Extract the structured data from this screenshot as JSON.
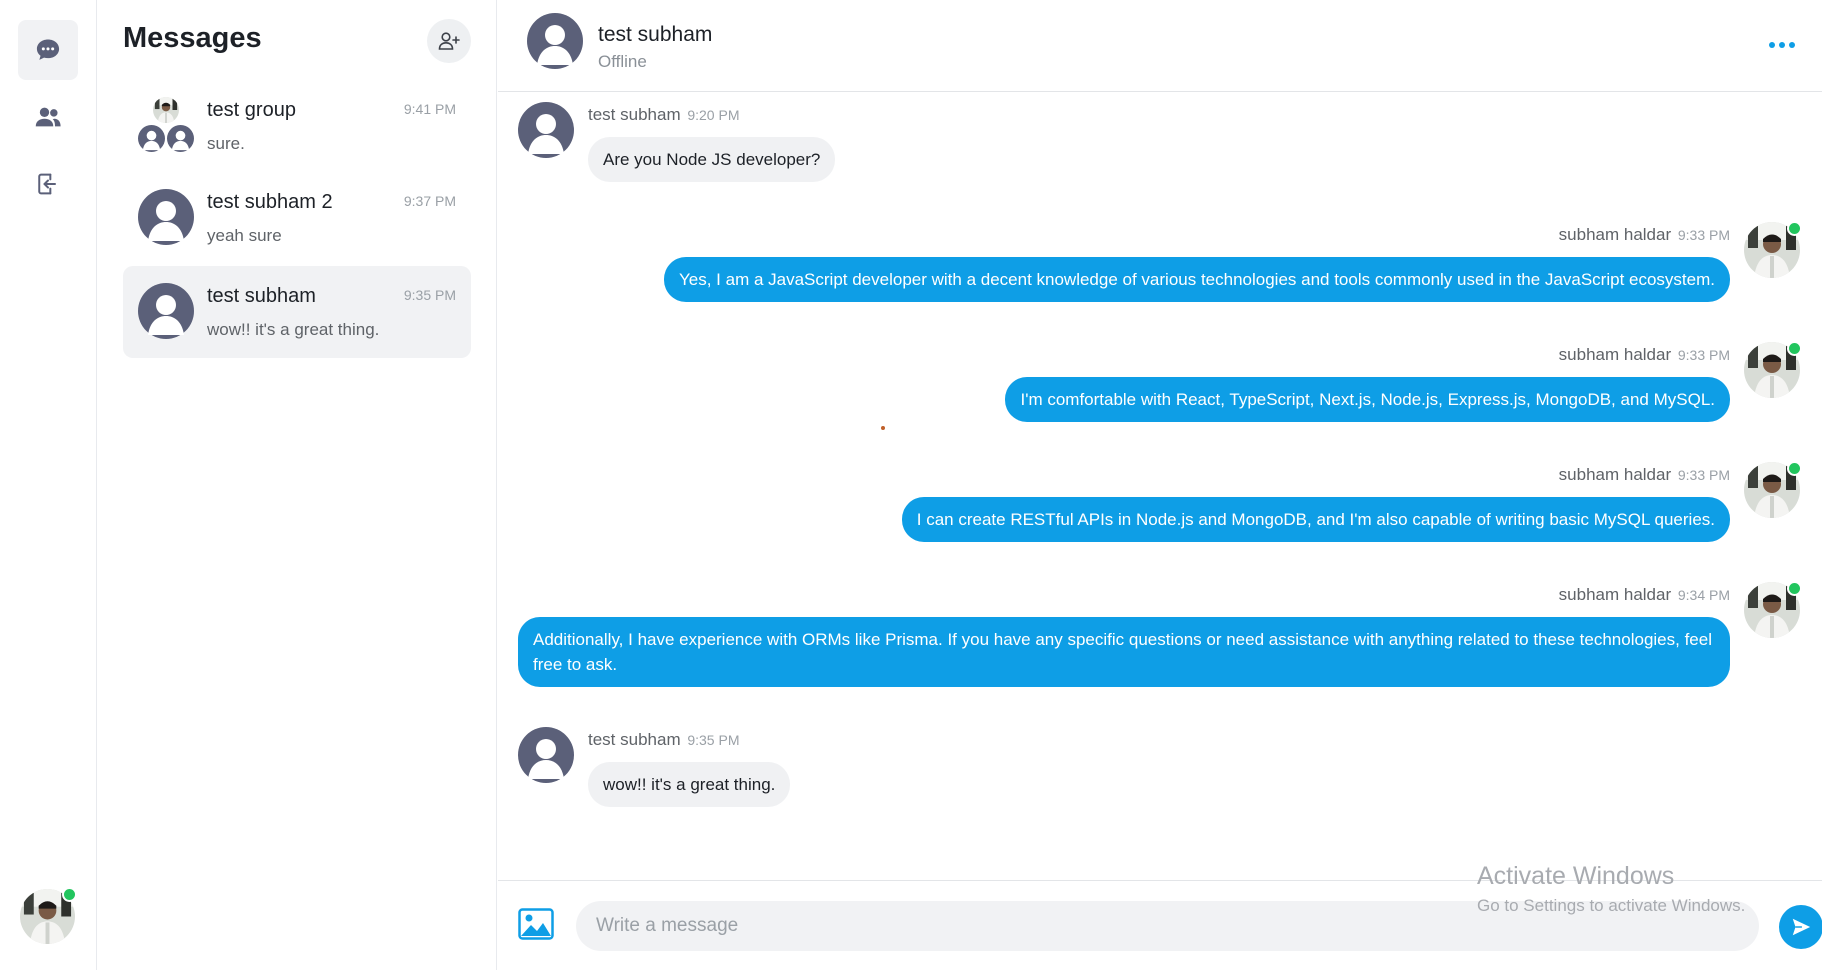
{
  "rail": {
    "items": [
      {
        "icon": "chat-bubble-icon",
        "active": true
      },
      {
        "icon": "users-icon",
        "active": false
      },
      {
        "icon": "logout-icon",
        "active": false
      }
    ]
  },
  "sidebar": {
    "title": "Messages",
    "add_icon": "add-user-icon",
    "conversations": [
      {
        "name": "test group",
        "time": "9:41 PM",
        "preview": "sure."
      },
      {
        "name": "test subham 2",
        "time": "9:37 PM",
        "preview": "yeah sure"
      },
      {
        "name": "test subham",
        "time": "9:35 PM",
        "preview": "wow!! it's a great thing."
      }
    ]
  },
  "chat": {
    "contact_name": "test subham",
    "contact_status": "Offline",
    "messages": [
      {
        "sender": "test subham",
        "time": "9:20 PM",
        "text": "Are you Node JS developer?"
      },
      {
        "sender": "subham haldar",
        "time": "9:33 PM",
        "text": "Yes, I am a JavaScript developer with a decent knowledge of various technologies and tools commonly used in the JavaScript ecosystem."
      },
      {
        "sender": "subham haldar",
        "time": "9:33 PM",
        "text": "I'm comfortable with React, TypeScript, Next.js, Node.js, Express.js, MongoDB, and MySQL."
      },
      {
        "sender": "subham haldar",
        "time": "9:33 PM",
        "text": "I can create RESTful APIs in Node.js and MongoDB, and I'm also capable of writing basic MySQL queries."
      },
      {
        "sender": "subham haldar",
        "time": "9:34 PM",
        "text": "Additionally, I have experience with ORMs like Prisma. If you have any specific questions or need assistance with anything related to these technologies, feel free to ask."
      },
      {
        "sender": "test subham",
        "time": "9:35 PM",
        "text": "wow!! it's a great thing."
      }
    ]
  },
  "composer": {
    "placeholder": "Write a message",
    "image_icon": "image-icon",
    "send_icon": "send-icon"
  },
  "watermark": {
    "line1": "Activate Windows",
    "line2": "Go to Settings to activate Windows."
  },
  "colors": {
    "accent": "#0e9ee6",
    "online": "#22c55e",
    "incoming_bubble": "#f0f1f3",
    "default_avatar": "#5b6079"
  }
}
